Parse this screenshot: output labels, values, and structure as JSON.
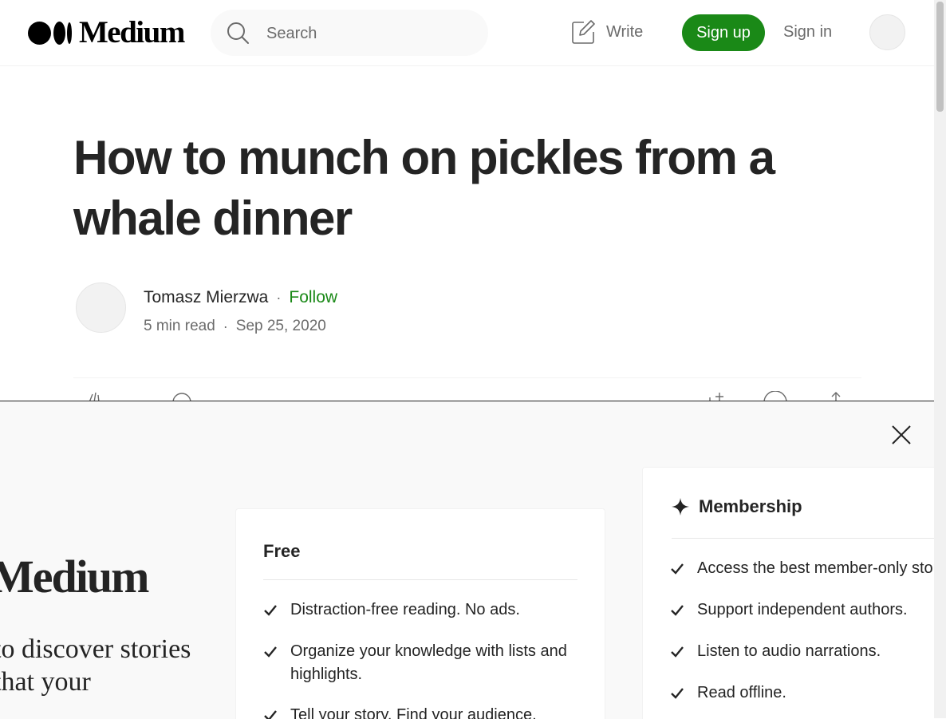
{
  "header": {
    "logo_text": "Medium",
    "search_placeholder": "Search",
    "write_label": "Write",
    "signup_label": "Sign up",
    "signin_label": "Sign in"
  },
  "article": {
    "title": "How to munch on pickles from a whale dinner",
    "author": "Tomasz Mierzwa",
    "follow_label": "Follow",
    "read_time": "5 min read",
    "date": "Sep 25, 2020"
  },
  "modal": {
    "logo_text": "Medium",
    "tagline": "to discover stories that your",
    "free": {
      "title": "Free",
      "features": [
        "Distraction-free reading. No ads.",
        "Organize your knowledge with lists and highlights.",
        "Tell your story. Find your audience."
      ]
    },
    "membership": {
      "title": "Membership",
      "features": [
        "Access the best member-only stories.",
        "Support independent authors.",
        "Listen to audio narrations.",
        "Read offline."
      ]
    }
  },
  "colors": {
    "accent_green": "#1a8917",
    "text_primary": "#242424",
    "text_secondary": "#6b6b6b"
  }
}
